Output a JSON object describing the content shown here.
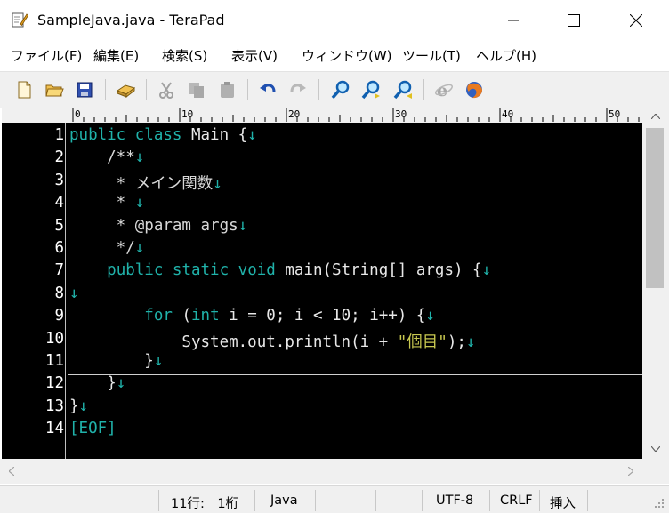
{
  "window": {
    "title": "SampleJava.java - TeraPad"
  },
  "menu": [
    "ファイル(F)",
    "編集(E)",
    "検索(S)",
    "表示(V)",
    "ウィンドウ(W)",
    "ツール(T)",
    "ヘルプ(H)"
  ],
  "toolbar": {
    "buttons": [
      "new-file-icon",
      "open-folder-icon",
      "save-icon",
      "print-icon",
      "cut-icon",
      "copy-icon",
      "paste-icon",
      "undo-icon",
      "redo-icon",
      "search-icon",
      "search-next-icon",
      "search-prev-icon",
      "ie-browser-icon",
      "firefox-browser-icon"
    ]
  },
  "ruler": {
    "labels": [
      "0",
      "10",
      "20",
      "30",
      "40",
      "50"
    ]
  },
  "editor": {
    "line_numbers": [
      "1",
      "2",
      "3",
      "4",
      "5",
      "6",
      "7",
      "8",
      "9",
      "10",
      "11",
      "12",
      "13",
      "14"
    ],
    "lines": [
      [
        {
          "t": "public class ",
          "c": "kw"
        },
        {
          "t": "Main {",
          "c": "plain"
        },
        {
          "t": "↓",
          "c": "crlf"
        }
      ],
      [
        {
          "t": "    /**",
          "c": "comment"
        },
        {
          "t": "↓",
          "c": "crlf"
        }
      ],
      [
        {
          "t": "     * メイン関数",
          "c": "comment"
        },
        {
          "t": "↓",
          "c": "crlf"
        }
      ],
      [
        {
          "t": "     * ",
          "c": "comment"
        },
        {
          "t": "↓",
          "c": "crlf"
        }
      ],
      [
        {
          "t": "     * @param args",
          "c": "comment"
        },
        {
          "t": "↓",
          "c": "crlf"
        }
      ],
      [
        {
          "t": "     */",
          "c": "comment"
        },
        {
          "t": "↓",
          "c": "crlf"
        }
      ],
      [
        {
          "t": "    ",
          "c": "plain"
        },
        {
          "t": "public static void ",
          "c": "kw"
        },
        {
          "t": "main(String[] args) {",
          "c": "plain"
        },
        {
          "t": "↓",
          "c": "crlf"
        }
      ],
      [
        {
          "t": "↓",
          "c": "crlf"
        }
      ],
      [
        {
          "t": "        ",
          "c": "plain"
        },
        {
          "t": "for ",
          "c": "kw"
        },
        {
          "t": "(",
          "c": "plain"
        },
        {
          "t": "int ",
          "c": "kw"
        },
        {
          "t": "i = 0; i < 10; i++) {",
          "c": "plain"
        },
        {
          "t": "↓",
          "c": "crlf"
        }
      ],
      [
        {
          "t": "            System.out.println(i + ",
          "c": "plain"
        },
        {
          "t": "\"個目\"",
          "c": "str"
        },
        {
          "t": ");",
          "c": "plain"
        },
        {
          "t": "↓",
          "c": "crlf"
        }
      ],
      [
        {
          "t": "        }",
          "c": "plain"
        },
        {
          "t": "↓",
          "c": "crlf"
        }
      ],
      [
        {
          "t": "    }",
          "c": "plain"
        },
        {
          "t": "↓",
          "c": "crlf"
        }
      ],
      [
        {
          "t": "}",
          "c": "plain"
        },
        {
          "t": "↓",
          "c": "crlf"
        }
      ],
      [
        {
          "t": "[EOF]",
          "c": "eof"
        }
      ]
    ]
  },
  "status": {
    "position": "11行:　1桁",
    "language": "Java",
    "encoding": "UTF-8",
    "line_ending": "CRLF",
    "mode": "挿入"
  }
}
